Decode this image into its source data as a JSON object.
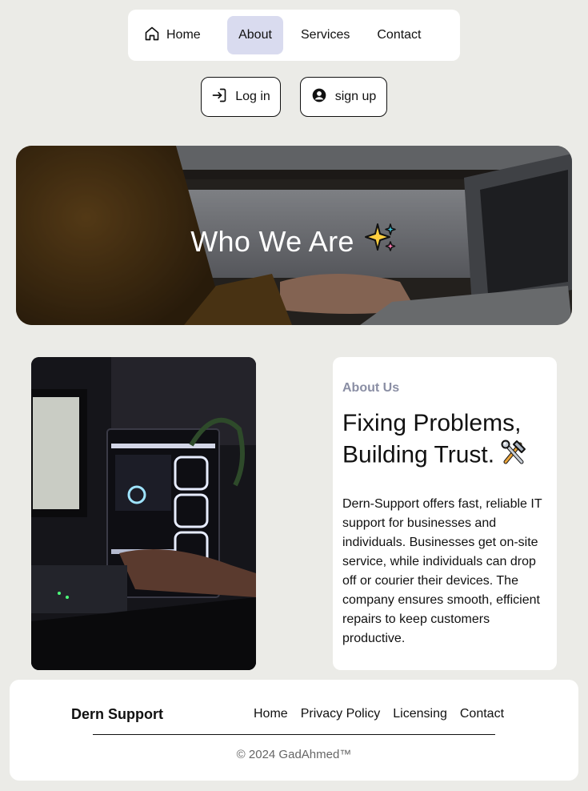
{
  "nav": {
    "items": [
      {
        "label": "Home",
        "icon": "home-icon"
      },
      {
        "label": "About",
        "active": true
      },
      {
        "label": "Services"
      },
      {
        "label": "Contact"
      }
    ],
    "active_color": "#d9dbef"
  },
  "auth": {
    "login_label": "Log in",
    "login_icon": "login-icon",
    "signup_label": "sign up",
    "signup_icon": "user-circle-icon"
  },
  "hero": {
    "title": "Who We Are",
    "emoji": "sparkles-icon"
  },
  "about": {
    "kicker": "About Us",
    "title_line1": "Fixing Problems,",
    "title_line2": "Building Trust.",
    "title_emoji": "hammer-and-wrench-icon",
    "body": "Dern-Support offers fast, reliable IT support for businesses and individuals. Businesses get on-site service, while individuals can drop off or courier their devices. The company ensures smooth, efficient repairs to keep customers productive."
  },
  "footer": {
    "brand": "Dern Support",
    "links": [
      "Home",
      "Privacy Policy",
      "Licensing",
      "Contact"
    ],
    "copyright": "© 2024 GadAhmed™"
  },
  "colors": {
    "page_bg": "#ebebe7",
    "kicker": "#8a8ea4"
  }
}
